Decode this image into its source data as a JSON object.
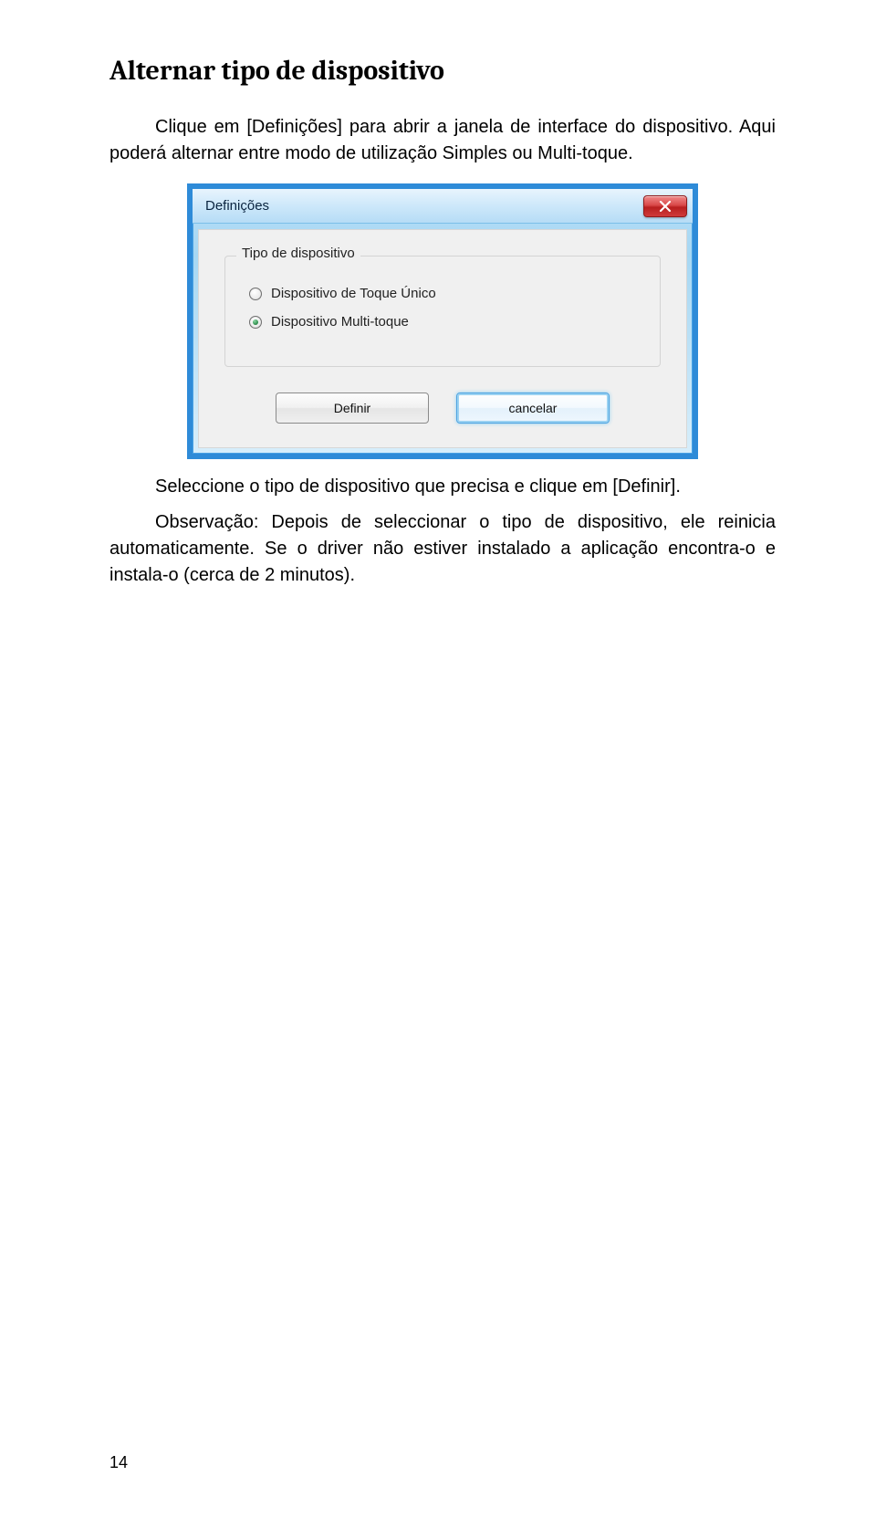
{
  "heading": "Alternar tipo de dispositivo",
  "para1": "Clique em [Definições] para abrir a janela de interface do dispositivo. Aqui poderá alternar entre modo de utilização Simples ou Multi-toque.",
  "para2": "Seleccione o tipo de dispositivo que precisa e clique em [Definir].",
  "para3": "Observação: Depois de seleccionar o tipo de dispositivo, ele reinicia automaticamente. Se o driver não estiver instalado a aplicação encontra-o e instala-o (cerca de 2 minutos).",
  "dialog": {
    "title": "Definições",
    "group_label": "Tipo de dispositivo",
    "option1": "Dispositivo de Toque Único",
    "option2": "Dispositivo Multi-toque",
    "btn_define": "Definir",
    "btn_cancel": "cancelar"
  },
  "page_number": "14"
}
